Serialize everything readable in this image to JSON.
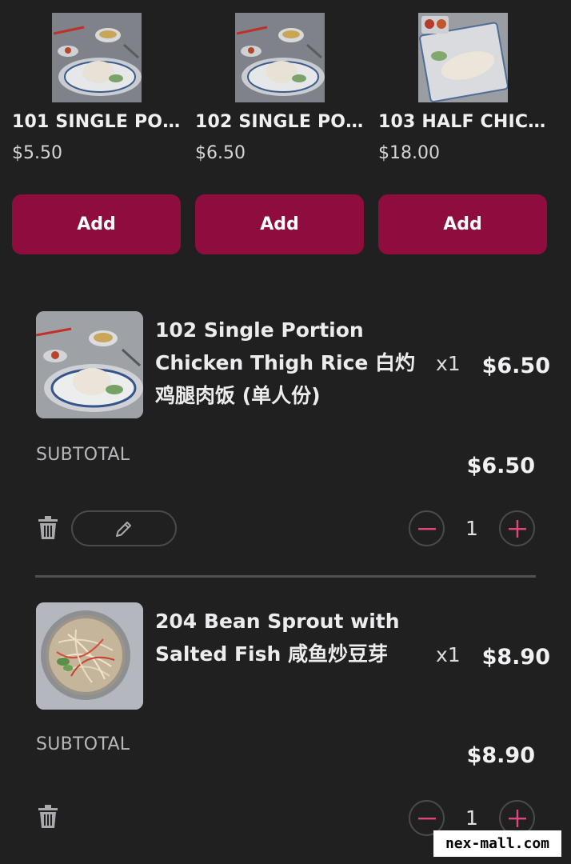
{
  "suggested_products": [
    {
      "name": "101 SINGLE POR…",
      "price": "$5.50",
      "add_label": "Add",
      "image": "chicken-rice-plate"
    },
    {
      "name": "102 SINGLE PO…",
      "price": "$6.50",
      "add_label": "Add",
      "image": "chicken-rice-plate"
    },
    {
      "name": "103 HALF CHIC…",
      "price": "$18.00",
      "add_label": "Add",
      "image": "half-chicken-platter"
    }
  ],
  "cart": {
    "items": [
      {
        "name": "102 Single Portion Chicken Thigh Rice 白灼鸡腿肉饭 (单人份)",
        "qty_label": "x1",
        "price": "$6.50",
        "subtotal_label": "SUBTOTAL",
        "subtotal": "$6.50",
        "quantity": "1",
        "image": "chicken-rice-plate"
      },
      {
        "name": "204 Bean Sprout with Salted Fish 咸鱼炒豆芽",
        "qty_label": "x1",
        "price": "$8.90",
        "subtotal_label": "SUBTOTAL",
        "subtotal": "$8.90",
        "quantity": "1",
        "image": "bean-sprout-plate"
      }
    ]
  },
  "icons": {
    "delete": "trash-icon",
    "edit": "pencil-icon",
    "decrement": "minus-icon",
    "increment": "plus-icon"
  },
  "colors": {
    "background": "#202021",
    "accent": "#8e0c3e",
    "stepper_glyph": "#e0457f"
  },
  "watermark": "nex-mall.com"
}
